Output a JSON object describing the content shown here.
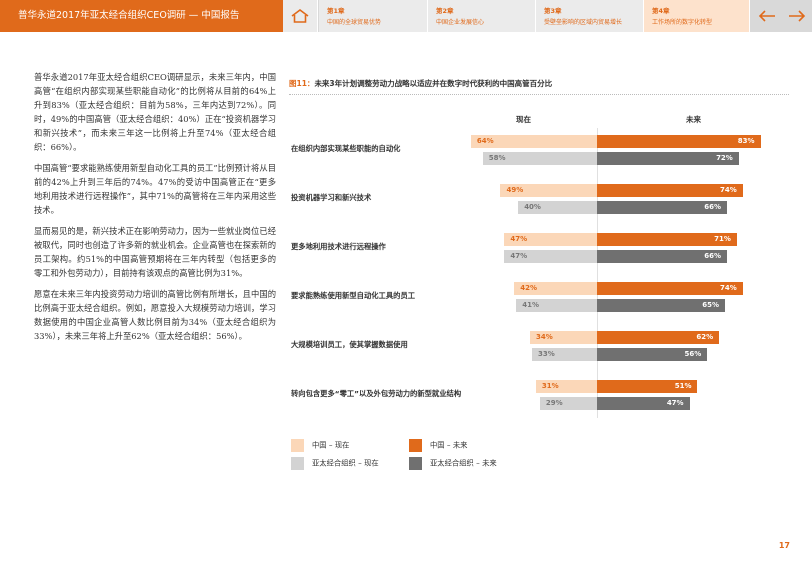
{
  "header": {
    "title": "普华永道2017年亚太经合组织CEO调研 — 中国报告",
    "tabs": [
      {
        "chapter": "第1章",
        "name": "中国的全球贸易优势"
      },
      {
        "chapter": "第2章",
        "name": "中国企业发展信心"
      },
      {
        "chapter": "第3章",
        "name": "受壁垒影响的区域内贸易增长"
      },
      {
        "chapter": "第4章",
        "name": "工作场所的数字化转型"
      }
    ],
    "home_icon": "home-icon",
    "prev_icon": "arrow-left-icon",
    "next_icon": "arrow-right-icon",
    "accent": "#e06a1b"
  },
  "body_text": [
    "普华永道2017年亚太经合组织CEO调研显示，未来三年内，中国高管“在组织内部实现某些职能自动化”的比例将从目前的64%上升到83%（亚太经合组织：目前为58%，三年内达到72%）。同时，49%的中国高管（亚太经合组织：40%）正在“投资机器学习和新兴技术”，而未来三年这一比例将上升至74%（亚太经合组织：66%）。",
    "中国高管“要求能熟练使用新型自动化工具的员工”比例预计将从目前的42%上升到三年后的74%。47%的受访中国高管正在“更多地利用技术进行远程操作”，其中71%的高管将在三年内采用这些技术。",
    "显而易见的是，新兴技术正在影响劳动力，因为一些就业岗位已经被取代，同时也创造了许多新的就业机会。企业高管也在探索新的员工架构。约51%的中国高管预期将在三年内转型（包括更多的零工和外包劳动力），目前持有该观点的高管比例为31%。",
    "愿意在未来三年内投资劳动力培训的高管比例有所增长，且中国的比例高于亚太经合组织。例如，愿意投入大规模劳动力培训，学习数据使用的中国企业高管人数比例目前为34%（亚太经合组织为33%），未来三年将上升至62%（亚太经合组织：56%）。"
  ],
  "figure": {
    "number": "图11：",
    "title": "未来3年计划调整劳动力战略以适应并在数字时代获利的中国高管百分比",
    "col_now": "现在",
    "col_future": "未来"
  },
  "chart_data": {
    "type": "bar",
    "categories": [
      "在组织内部实现某些职能的自动化",
      "投资机器学习和新兴技术",
      "更多地利用技术进行远程操作",
      "要求能熟练使用新型自动化工具的员工",
      "大规模培训员工，使其掌握数据使用",
      "转向包含更多“零工”以及外包劳动力的新型就业结构"
    ],
    "series": [
      {
        "name": "中国 – 现在",
        "values": [
          64,
          49,
          47,
          42,
          34,
          31
        ],
        "color": "#fbd7b8"
      },
      {
        "name": "亚太经合组织 – 现在",
        "values": [
          58,
          40,
          47,
          41,
          33,
          29
        ],
        "color": "#d3d3d3"
      },
      {
        "name": "中国 – 未来",
        "values": [
          83,
          74,
          71,
          74,
          62,
          51
        ],
        "color": "#e06a1b"
      },
      {
        "name": "亚太经合组织 – 未来",
        "values": [
          72,
          66,
          66,
          65,
          56,
          47
        ],
        "color": "#707070"
      }
    ],
    "unit": "%",
    "legend": "bottom"
  },
  "legend": [
    {
      "label": "中国  –  现在",
      "color": "#fbd7b8"
    },
    {
      "label": "中国  –  未来",
      "color": "#e06a1b"
    },
    {
      "label": "亚太经合组织  –  现在",
      "color": "#d3d3d3"
    },
    {
      "label": "亚太经合组织  –  未来",
      "color": "#707070"
    }
  ],
  "page_number": "17"
}
